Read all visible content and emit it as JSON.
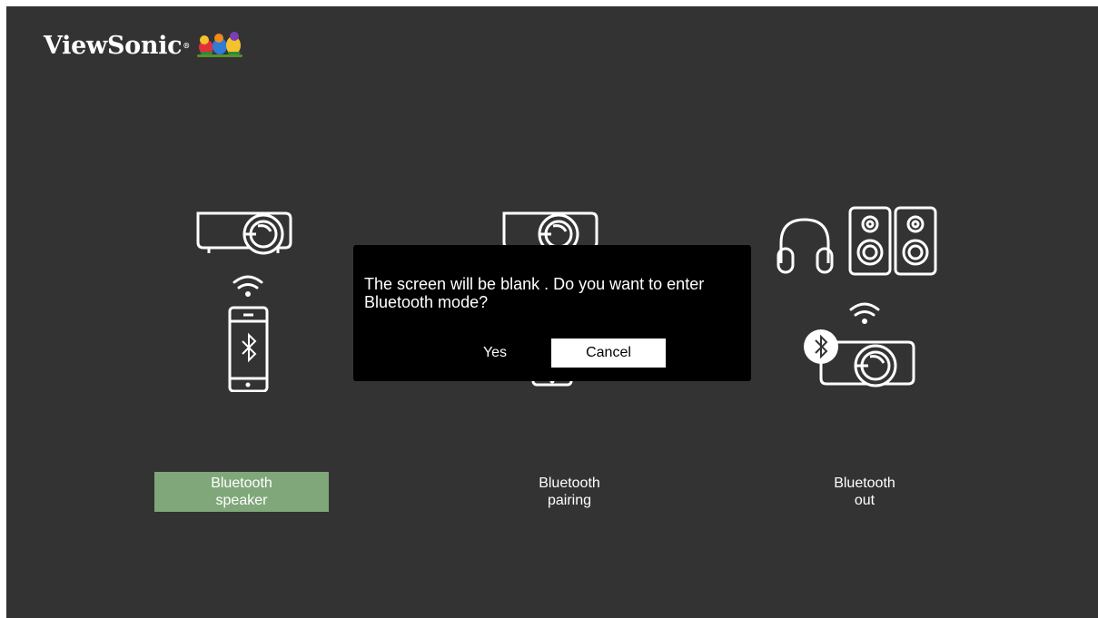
{
  "brand": {
    "name": "ViewSonic",
    "reg_mark": "®"
  },
  "options": [
    {
      "line1": "Bluetooth",
      "line2": "speaker",
      "selected": true
    },
    {
      "line1": "Bluetooth",
      "line2": "pairing",
      "selected": false
    },
    {
      "line1": "Bluetooth",
      "line2": "out",
      "selected": false
    }
  ],
  "dialog": {
    "message": "The screen will be blank . Do you want to enter Bluetooth mode?",
    "yes_label": "Yes",
    "cancel_label": "Cancel"
  },
  "icons": [
    "projector-icon",
    "wifi-icon",
    "smartphone-icon",
    "bluetooth-icon",
    "headphones-icon",
    "speakers-icon"
  ],
  "colors": {
    "background": "#333333",
    "selected": "#80a77a",
    "dialog": "#000000"
  }
}
